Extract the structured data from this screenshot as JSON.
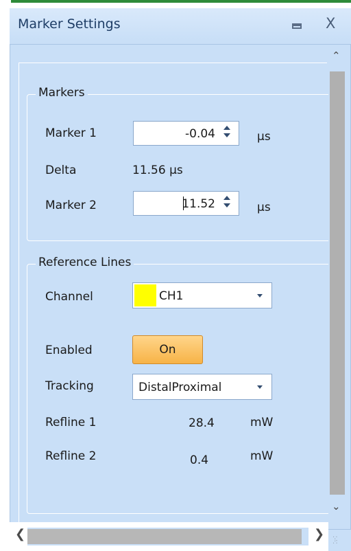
{
  "window": {
    "title": "Marker Settings",
    "minimize_icon": "minimize-icon",
    "close_label": "X"
  },
  "markers": {
    "group_title": "Markers",
    "marker1": {
      "label": "Marker 1",
      "value": "-0.04",
      "unit": "µs"
    },
    "delta": {
      "label": "Delta",
      "value": "11.56 µs"
    },
    "marker2": {
      "label": "Marker 2",
      "value": "11.52",
      "unit": "µs"
    }
  },
  "reference_lines": {
    "group_title": "Reference Lines",
    "channel": {
      "label": "Channel",
      "value": "CH1",
      "swatch_color": "#ffff00"
    },
    "enabled": {
      "label": "Enabled",
      "value": "On"
    },
    "tracking": {
      "label": "Tracking",
      "value": "DistalProximal"
    },
    "refline1": {
      "label": "Refline 1",
      "value": "28.4",
      "unit": "mW"
    },
    "refline2": {
      "label": "Refline 2",
      "value": "0.4",
      "unit": "mW"
    }
  },
  "colors": {
    "panel_bg": "#c9dff7",
    "toggle_on": "#f7b347",
    "title_text": "#1e3d66"
  }
}
